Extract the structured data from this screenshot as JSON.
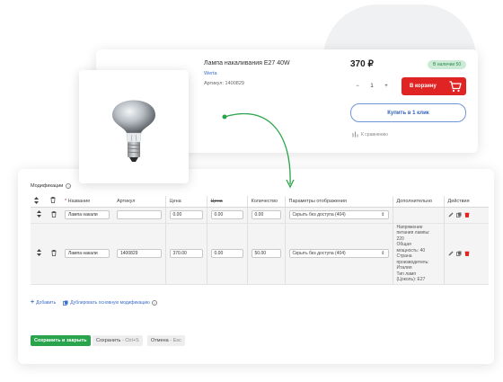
{
  "product": {
    "title": "Лампа накаливания E27 40W",
    "brand": "Werta",
    "sku_label": "Артикул: 1400829",
    "price": "370 ₽",
    "stock_badge": "В наличии 50",
    "qty_value": "1",
    "qty_minus": "−",
    "qty_plus": "+",
    "cart_label": "В корзину",
    "buy_one_click_label": "Купить в 1 клик",
    "compare_label": "К сравнению"
  },
  "modifications": {
    "section_label": "Модификации",
    "columns": {
      "name": "Название",
      "article": "Артикул",
      "price": "Цена",
      "old_price": "Цена",
      "quantity": "Количество",
      "display_params": "Параметры отображения",
      "extra": "Дополнительно",
      "actions": "Действия"
    },
    "rows": [
      {
        "name": "Лампа накали",
        "article": "",
        "price": "0.00",
        "old_price": "0.00",
        "quantity": "0.00",
        "display": "Скрыть без доступа (404)",
        "extra": []
      },
      {
        "name": "Лампа накали",
        "article": "1400829",
        "price": "370.00",
        "old_price": "0.00",
        "quantity": "50.00",
        "display": "Скрыть без доступа (404)",
        "extra": [
          "Напряжение",
          "питания лампы:",
          "220",
          "Общая",
          "мощность: 40",
          "Страна",
          "производитель:",
          "Италия",
          "Тип ламп",
          "(Цоколь): E27"
        ]
      }
    ],
    "add_link": "Добавить",
    "duplicate_link": "Дублировать основную модификацию"
  },
  "footer": {
    "save_close": "Сохранить и закрыть",
    "save": "Сохранить",
    "save_key": "- Ctrl+S",
    "cancel": "Отмена",
    "cancel_key": "- Esc"
  },
  "colors": {
    "cart_red": "#e02323",
    "save_green": "#29a44c",
    "link_blue": "#3b6ec8",
    "arrow_green": "#2aa34a",
    "stock_bg": "#ccebd6"
  }
}
